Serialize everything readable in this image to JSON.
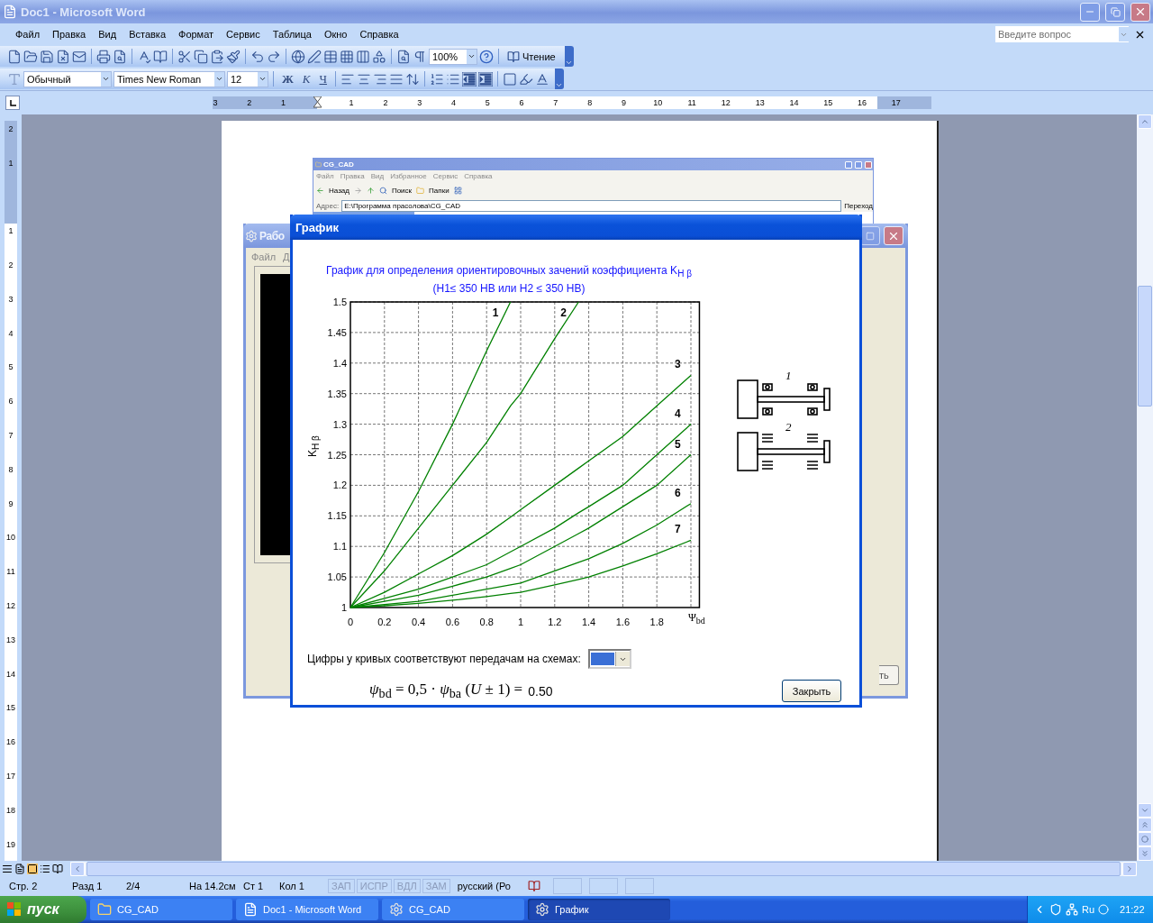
{
  "window": {
    "title": "Doc1 - Microsoft Word"
  },
  "menu": [
    "Файл",
    "Правка",
    "Вид",
    "Вставка",
    "Формат",
    "Сервис",
    "Таблица",
    "Окно",
    "Справка"
  ],
  "help_box": {
    "placeholder": "Введите вопрос"
  },
  "standard_toolbar": {
    "zoom": "100%",
    "reading_button": "Чтение"
  },
  "formatting_toolbar": {
    "style": "Обычный",
    "font": "Times New Roman",
    "size": "12",
    "buttons": [
      "Ж",
      "К",
      "Ч"
    ]
  },
  "ruler": {
    "left_numbers": [
      "3",
      "2",
      "1"
    ],
    "numbers": [
      "1",
      "2",
      "3",
      "4",
      "5",
      "6",
      "7",
      "8",
      "9",
      "10",
      "11",
      "12",
      "13",
      "14",
      "15",
      "16",
      "17"
    ]
  },
  "vertical_ruler": {
    "top_numbers": [
      "2",
      "1"
    ],
    "numbers": [
      "1",
      "2",
      "3",
      "4",
      "5",
      "6",
      "7",
      "8",
      "9",
      "10",
      "11",
      "12",
      "13",
      "14",
      "15",
      "16",
      "17",
      "18",
      "19"
    ]
  },
  "embedded_window": {
    "title": "CG_CAD",
    "menu": [
      "Файл",
      "Правка",
      "Вид",
      "Избранное",
      "Сервис",
      "Справка"
    ],
    "toolbar": [
      "Назад",
      "Поиск",
      "Папки"
    ],
    "address_label": "Адрес:",
    "address": "E:\\Программа прасолова\\CG_CAD",
    "go_button": "Переход"
  },
  "back_window": {
    "title": "Рабо",
    "menu": [
      "Файл",
      "Д"
    ],
    "button": "ть"
  },
  "dialog": {
    "title": "График",
    "chart_data": {
      "type": "line",
      "title": "График для определения ориентировочных зачений коэффициента K$_{H β}$",
      "xlabel": "Ψ$_{bd}$",
      "ylabel": "K$_{H β}$",
      "x": [
        0,
        0.2,
        0.4,
        0.6,
        0.8,
        0.94,
        1,
        1.2,
        1.34,
        1.4,
        1.6,
        1.8,
        2
      ],
      "series": [
        {
          "name": "1",
          "color": "#008000",
          "values": [
            1,
            1.09,
            1.19,
            1.3,
            1.42,
            1.5,
            null,
            null,
            null,
            null,
            null,
            null,
            null
          ]
        },
        {
          "name": "2",
          "color": "#008000",
          "values": [
            1,
            1.06,
            1.13,
            1.2,
            1.27,
            1.33,
            1.35,
            1.44,
            1.5,
            null,
            null,
            null,
            null
          ]
        },
        {
          "name": "3",
          "color": "#008000",
          "values": [
            1,
            1.025,
            1.055,
            1.085,
            1.12,
            1.148,
            1.16,
            1.2,
            1.228,
            1.24,
            1.28,
            1.33,
            1.38
          ]
        },
        {
          "name": "4",
          "color": "#008000",
          "values": [
            1,
            1.015,
            1.03,
            1.05,
            1.07,
            1.091,
            1.1,
            1.13,
            1.155,
            1.165,
            1.2,
            1.25,
            1.3
          ]
        },
        {
          "name": "5",
          "color": "#008000",
          "values": [
            1,
            1.01,
            1.02,
            1.035,
            1.05,
            1.064,
            1.07,
            1.1,
            1.121,
            1.13,
            1.165,
            1.2,
            1.25
          ]
        },
        {
          "name": "6",
          "color": "#008000",
          "values": [
            1,
            1.005,
            1.01,
            1.02,
            1.03,
            1.037,
            1.04,
            1.06,
            1.074,
            1.08,
            1.105,
            1.135,
            1.17
          ]
        },
        {
          "name": "7",
          "color": "#008000",
          "values": [
            1,
            1.003,
            1.007,
            1.012,
            1.018,
            1.023,
            1.025,
            1.037,
            1.046,
            1.05,
            1.068,
            1.088,
            1.11
          ]
        }
      ],
      "xlim": [
        0,
        2.05
      ],
      "ylim": [
        1,
        1.5
      ],
      "xticks": [
        0,
        0.2,
        0.4,
        0.6,
        0.8,
        1,
        1.2,
        1.4,
        1.6,
        1.8
      ],
      "yticks": [
        1,
        1.05,
        1.1,
        1.15,
        1.2,
        1.25,
        1.3,
        1.35,
        1.4,
        1.45,
        1.5
      ],
      "grid": true
    },
    "subtitle": "(H1≤ 350 HB или H2 ≤ 350 HB)",
    "scheme_labels": [
      "1",
      "2"
    ],
    "legend_note": "Цифры у кривых соответствуют передачам на схемах:",
    "formula": "*ψ*$_{bd}$ = 0,5 · *ψ*$_{ba}$ (*U* ± 1) =",
    "formula_value": "0.50",
    "close_button": "Закрыть"
  },
  "status_bar": {
    "items": [
      "Стр. 2",
      "Разд 1",
      "2/4",
      "На 14.2см",
      "Ст 1",
      "Кол 1"
    ],
    "modes": [
      {
        "label": "ЗАП",
        "on": false
      },
      {
        "label": "ИСПР",
        "on": false
      },
      {
        "label": "ВДЛ",
        "on": false
      },
      {
        "label": "ЗАМ",
        "on": false
      }
    ],
    "language": "русский (Ро"
  },
  "taskbar": {
    "start": "пуск",
    "tasks": [
      {
        "label": "CG_CAD",
        "selected": false,
        "kind": "folder"
      },
      {
        "label": "Doc1 - Microsoft Word",
        "selected": false,
        "kind": "word"
      },
      {
        "label": "CG_CAD",
        "selected": false,
        "kind": "gear"
      },
      {
        "label": "График",
        "selected": true,
        "kind": "gear"
      }
    ],
    "tray": {
      "language": "Ru",
      "clock": "21:22"
    }
  }
}
